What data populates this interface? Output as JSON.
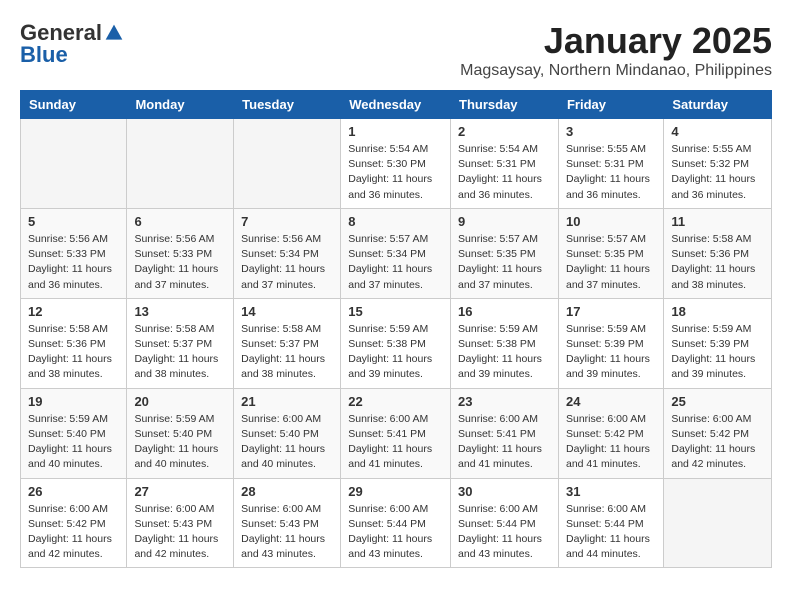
{
  "logo": {
    "general": "General",
    "blue": "Blue"
  },
  "header": {
    "month": "January 2025",
    "location": "Magsaysay, Northern Mindanao, Philippines"
  },
  "weekdays": [
    "Sunday",
    "Monday",
    "Tuesday",
    "Wednesday",
    "Thursday",
    "Friday",
    "Saturday"
  ],
  "weeks": [
    [
      {
        "day": "",
        "info": ""
      },
      {
        "day": "",
        "info": ""
      },
      {
        "day": "",
        "info": ""
      },
      {
        "day": "1",
        "info": "Sunrise: 5:54 AM\nSunset: 5:30 PM\nDaylight: 11 hours\nand 36 minutes."
      },
      {
        "day": "2",
        "info": "Sunrise: 5:54 AM\nSunset: 5:31 PM\nDaylight: 11 hours\nand 36 minutes."
      },
      {
        "day": "3",
        "info": "Sunrise: 5:55 AM\nSunset: 5:31 PM\nDaylight: 11 hours\nand 36 minutes."
      },
      {
        "day": "4",
        "info": "Sunrise: 5:55 AM\nSunset: 5:32 PM\nDaylight: 11 hours\nand 36 minutes."
      }
    ],
    [
      {
        "day": "5",
        "info": "Sunrise: 5:56 AM\nSunset: 5:33 PM\nDaylight: 11 hours\nand 36 minutes."
      },
      {
        "day": "6",
        "info": "Sunrise: 5:56 AM\nSunset: 5:33 PM\nDaylight: 11 hours\nand 37 minutes."
      },
      {
        "day": "7",
        "info": "Sunrise: 5:56 AM\nSunset: 5:34 PM\nDaylight: 11 hours\nand 37 minutes."
      },
      {
        "day": "8",
        "info": "Sunrise: 5:57 AM\nSunset: 5:34 PM\nDaylight: 11 hours\nand 37 minutes."
      },
      {
        "day": "9",
        "info": "Sunrise: 5:57 AM\nSunset: 5:35 PM\nDaylight: 11 hours\nand 37 minutes."
      },
      {
        "day": "10",
        "info": "Sunrise: 5:57 AM\nSunset: 5:35 PM\nDaylight: 11 hours\nand 37 minutes."
      },
      {
        "day": "11",
        "info": "Sunrise: 5:58 AM\nSunset: 5:36 PM\nDaylight: 11 hours\nand 38 minutes."
      }
    ],
    [
      {
        "day": "12",
        "info": "Sunrise: 5:58 AM\nSunset: 5:36 PM\nDaylight: 11 hours\nand 38 minutes."
      },
      {
        "day": "13",
        "info": "Sunrise: 5:58 AM\nSunset: 5:37 PM\nDaylight: 11 hours\nand 38 minutes."
      },
      {
        "day": "14",
        "info": "Sunrise: 5:58 AM\nSunset: 5:37 PM\nDaylight: 11 hours\nand 38 minutes."
      },
      {
        "day": "15",
        "info": "Sunrise: 5:59 AM\nSunset: 5:38 PM\nDaylight: 11 hours\nand 39 minutes."
      },
      {
        "day": "16",
        "info": "Sunrise: 5:59 AM\nSunset: 5:38 PM\nDaylight: 11 hours\nand 39 minutes."
      },
      {
        "day": "17",
        "info": "Sunrise: 5:59 AM\nSunset: 5:39 PM\nDaylight: 11 hours\nand 39 minutes."
      },
      {
        "day": "18",
        "info": "Sunrise: 5:59 AM\nSunset: 5:39 PM\nDaylight: 11 hours\nand 39 minutes."
      }
    ],
    [
      {
        "day": "19",
        "info": "Sunrise: 5:59 AM\nSunset: 5:40 PM\nDaylight: 11 hours\nand 40 minutes."
      },
      {
        "day": "20",
        "info": "Sunrise: 5:59 AM\nSunset: 5:40 PM\nDaylight: 11 hours\nand 40 minutes."
      },
      {
        "day": "21",
        "info": "Sunrise: 6:00 AM\nSunset: 5:40 PM\nDaylight: 11 hours\nand 40 minutes."
      },
      {
        "day": "22",
        "info": "Sunrise: 6:00 AM\nSunset: 5:41 PM\nDaylight: 11 hours\nand 41 minutes."
      },
      {
        "day": "23",
        "info": "Sunrise: 6:00 AM\nSunset: 5:41 PM\nDaylight: 11 hours\nand 41 minutes."
      },
      {
        "day": "24",
        "info": "Sunrise: 6:00 AM\nSunset: 5:42 PM\nDaylight: 11 hours\nand 41 minutes."
      },
      {
        "day": "25",
        "info": "Sunrise: 6:00 AM\nSunset: 5:42 PM\nDaylight: 11 hours\nand 42 minutes."
      }
    ],
    [
      {
        "day": "26",
        "info": "Sunrise: 6:00 AM\nSunset: 5:42 PM\nDaylight: 11 hours\nand 42 minutes."
      },
      {
        "day": "27",
        "info": "Sunrise: 6:00 AM\nSunset: 5:43 PM\nDaylight: 11 hours\nand 42 minutes."
      },
      {
        "day": "28",
        "info": "Sunrise: 6:00 AM\nSunset: 5:43 PM\nDaylight: 11 hours\nand 43 minutes."
      },
      {
        "day": "29",
        "info": "Sunrise: 6:00 AM\nSunset: 5:44 PM\nDaylight: 11 hours\nand 43 minutes."
      },
      {
        "day": "30",
        "info": "Sunrise: 6:00 AM\nSunset: 5:44 PM\nDaylight: 11 hours\nand 43 minutes."
      },
      {
        "day": "31",
        "info": "Sunrise: 6:00 AM\nSunset: 5:44 PM\nDaylight: 11 hours\nand 44 minutes."
      },
      {
        "day": "",
        "info": ""
      }
    ]
  ]
}
